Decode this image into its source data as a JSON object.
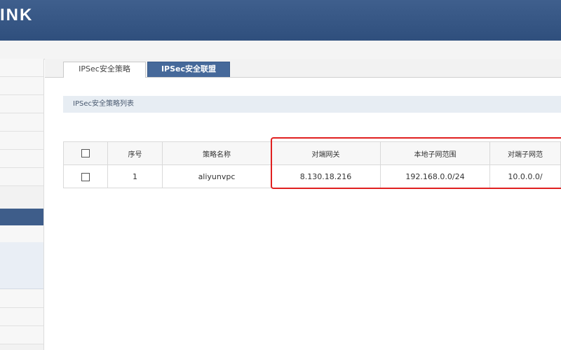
{
  "brand": {
    "logo_text": "INK"
  },
  "tabs": [
    {
      "label": "IPSec安全策略",
      "active": true
    },
    {
      "label": "IPSec安全联盟",
      "active": false
    }
  ],
  "section": {
    "title": "IPSec安全策略列表"
  },
  "table": {
    "headers": {
      "index": "序号",
      "name": "策略名称",
      "peer_gateway": "对端网关",
      "local_subnet": "本地子网范围",
      "remote_subnet": "对端子网范"
    },
    "rows": [
      {
        "index": "1",
        "name": "aliyunvpc",
        "peer_gateway": "8.130.18.216",
        "local_subnet": "192.168.0.0/24",
        "remote_subnet": "10.0.0.0/"
      }
    ]
  },
  "colors": {
    "header_bg": "#3f5f8d",
    "tab_inactive_bg": "#46699a",
    "highlight": "#e02020"
  }
}
